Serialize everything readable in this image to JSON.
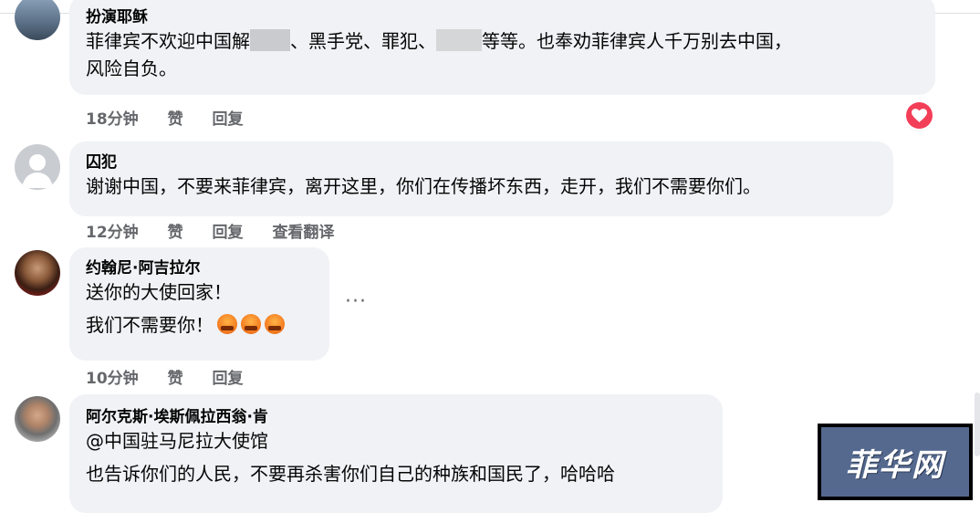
{
  "comments": [
    {
      "author": "扮演耶稣",
      "line1_a": "菲律宾不欢迎中国解",
      "line1_b": "、黑手党、罪犯、",
      "line1_c": "等等。也奉劝菲律宾人千万别去中国，",
      "line2": "风险自负。",
      "time": "18分钟",
      "like": "赞",
      "reply": "回复",
      "reaction": "love"
    },
    {
      "author": "囚犯",
      "line1": "谢谢中国，不要来菲律宾，离开这里，你们在传播坏东西，走开，我们不需要你们。",
      "time": "12分钟",
      "like": "赞",
      "reply": "回复",
      "translate": "查看翻译"
    },
    {
      "author": "约翰尼·阿吉拉尔",
      "line1": "送你的大使回家！",
      "line2": "我们不需要你！",
      "time": "10分钟",
      "like": "赞",
      "reply": "回复",
      "more": "···",
      "emoji_count": 3
    },
    {
      "author": "阿尔克斯·埃斯佩拉西翁·肯",
      "line1": "@中国驻马尼拉大使馆",
      "line2": "也告诉你们的人民，不要再杀害你们自己的种族和国民了，哈哈哈"
    }
  ],
  "watermark": "菲华网",
  "colors": {
    "bubble": "#f0f2f5",
    "meta": "#65676b",
    "love": "#f33e58",
    "watermark_bg": "#55698f"
  }
}
